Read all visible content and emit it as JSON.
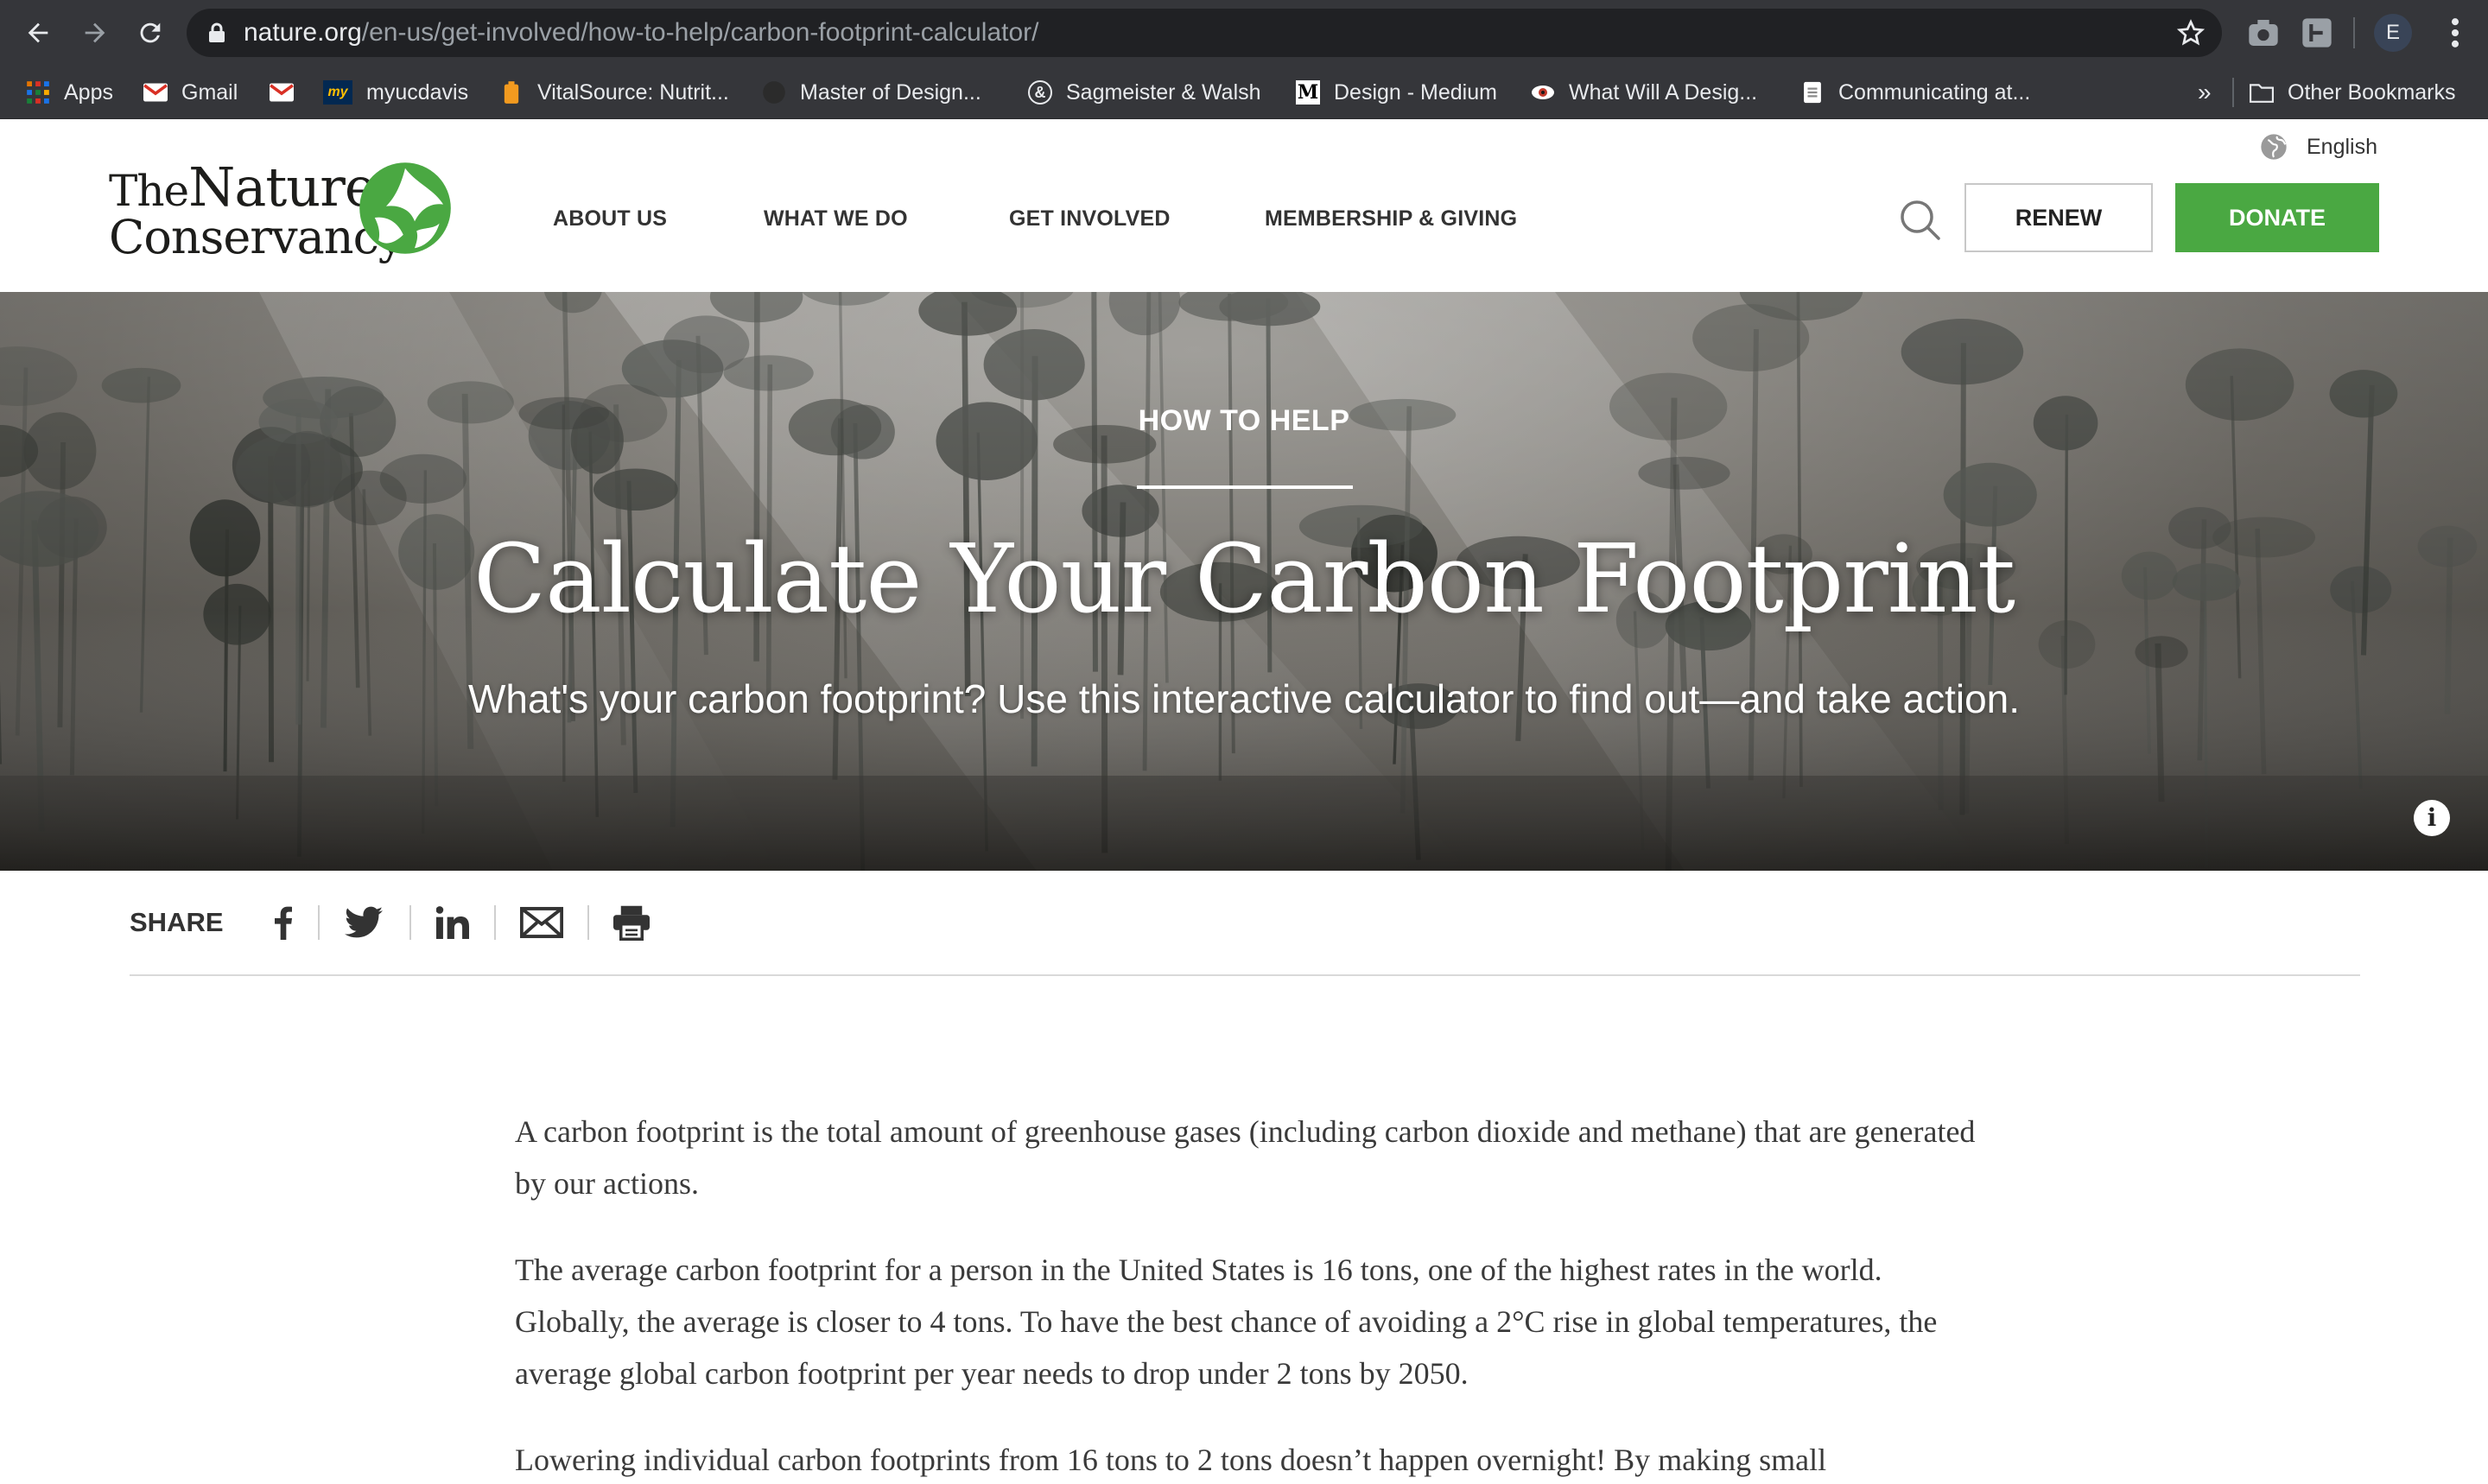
{
  "browser": {
    "url_domain": "nature.org",
    "url_path": "/en-us/get-involved/how-to-help/carbon-footprint-calculator/",
    "profile_initial": "E",
    "bookmarks": [
      {
        "label": "Apps",
        "icon": "apps-grid-icon"
      },
      {
        "label": "Gmail",
        "icon": "gmail-icon"
      },
      {
        "label": "",
        "icon": "gmail-icon"
      },
      {
        "label": "myucdavis",
        "icon": "myucdavis-icon"
      },
      {
        "label": "VitalSource: Nutrit...",
        "icon": "vitalsource-icon"
      },
      {
        "label": "Master of Design...",
        "icon": "site-icon"
      },
      {
        "label": "Sagmeister & Walsh",
        "icon": "sagmeister-icon"
      },
      {
        "label": "Design - Medium",
        "icon": "medium-icon"
      },
      {
        "label": "What Will A Desig...",
        "icon": "eye-icon"
      },
      {
        "label": "Communicating at...",
        "icon": "doc-icon"
      }
    ],
    "overflow_label": "»",
    "other_bookmarks": "Other Bookmarks"
  },
  "header": {
    "logo_line1_the": "The",
    "logo_line1_nature": "Nature",
    "logo_line2": "Conservancy",
    "nav": [
      "ABOUT US",
      "WHAT WE DO",
      "GET INVOLVED",
      "MEMBERSHIP & GIVING"
    ],
    "language": "English",
    "renew_label": "RENEW",
    "donate_label": "DONATE",
    "brand_green": "#4aa842"
  },
  "hero": {
    "eyebrow": "HOW TO HELP",
    "title": "Calculate Your Carbon Footprint",
    "subtitle": "What's your carbon footprint? Use this interactive calculator to find out—and take action.",
    "info_icon": "i"
  },
  "share": {
    "label": "SHARE",
    "buttons": [
      "facebook-icon",
      "twitter-icon",
      "linkedin-icon",
      "email-icon",
      "print-icon"
    ]
  },
  "article": {
    "paragraphs": [
      "A carbon footprint is the total amount of greenhouse gases (including carbon dioxide and methane) that are generated by our actions.",
      "The average carbon footprint for a person in the United States is 16 tons, one of the highest rates in the world. Globally, the average is closer to 4 tons. To have the best chance of avoiding a 2°C rise in global temperatures, the average global carbon footprint per year needs to drop under 2 tons by 2050.",
      "Lowering individual carbon footprints from 16 tons to 2 tons doesn’t happen overnight! By making small"
    ]
  }
}
